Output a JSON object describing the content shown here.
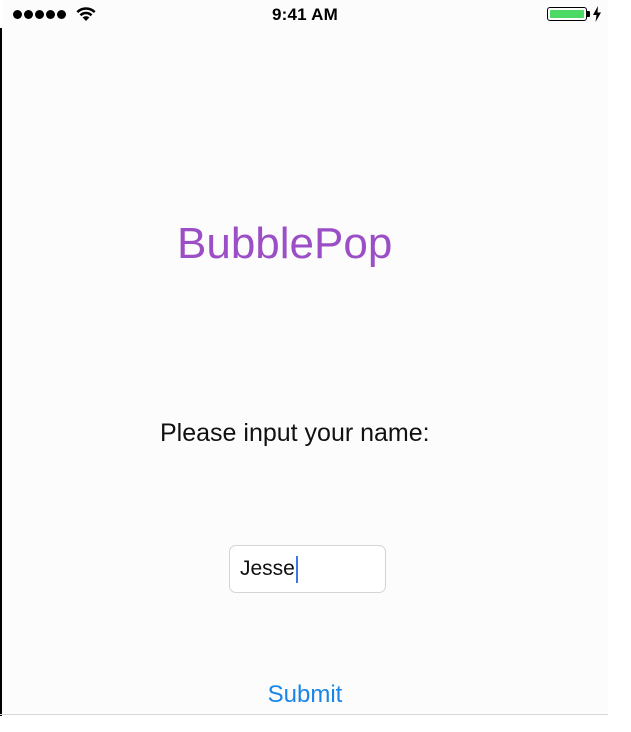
{
  "status_bar": {
    "time": "9:41 AM",
    "signal_icon": "signal-dots-icon",
    "wifi_icon": "wifi-icon",
    "battery_icon": "battery-icon",
    "charging_icon": "charging-bolt-icon",
    "battery_color": "#4cd964"
  },
  "app": {
    "title": "BubblePop",
    "title_color": "#9b4ec6"
  },
  "form": {
    "prompt": "Please input your name:",
    "name_value": "Jesse",
    "caret_color": "#3b78e7",
    "submit_label": "Submit",
    "submit_color": "#1a85e8"
  }
}
